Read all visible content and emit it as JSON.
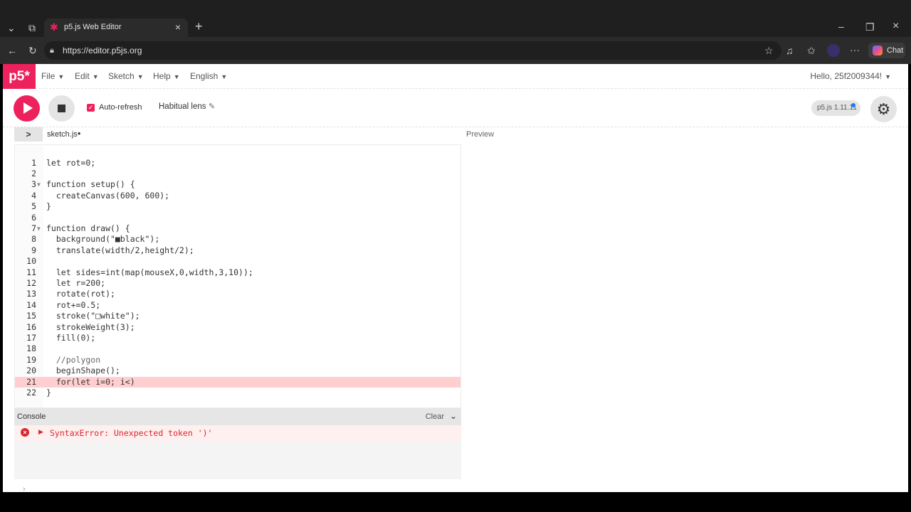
{
  "browser": {
    "tab_title": "p5.js Web Editor",
    "url": "https://editor.p5js.org",
    "chat_label": "Chat"
  },
  "app": {
    "logo": "p5*",
    "menus": [
      "File",
      "Edit",
      "Sketch",
      "Help",
      "English"
    ],
    "user_greeting": "Hello, 25f2009344!",
    "auto_refresh_label": "Auto-refresh",
    "sketch_name": "Habitual lens",
    "version": "p5.js 1.11.11",
    "file_tab": "sketch.js",
    "preview_label": "Preview"
  },
  "editor": {
    "lines": [
      "let rot=0;",
      "",
      "function setup() {",
      "  createCanvas(600, 600);",
      "}",
      "",
      "function draw() {",
      "  background(\"■black\");",
      "  translate(width/2,height/2);",
      "",
      "  let sides=int(map(mouseX,0,width,3,10));",
      "  let r=200;",
      "  rotate(rot);",
      "  rot+=0.5;",
      "  stroke(\"□white\");",
      "  strokeWeight(3);",
      "  fill(0);",
      "",
      "  //polygon",
      "  beginShape();",
      "  for(let i=0; i<)",
      "}"
    ],
    "error_line": 21
  },
  "console": {
    "label": "Console",
    "clear_label": "Clear",
    "error_message": "SyntaxError: Unexpected token ')'"
  }
}
